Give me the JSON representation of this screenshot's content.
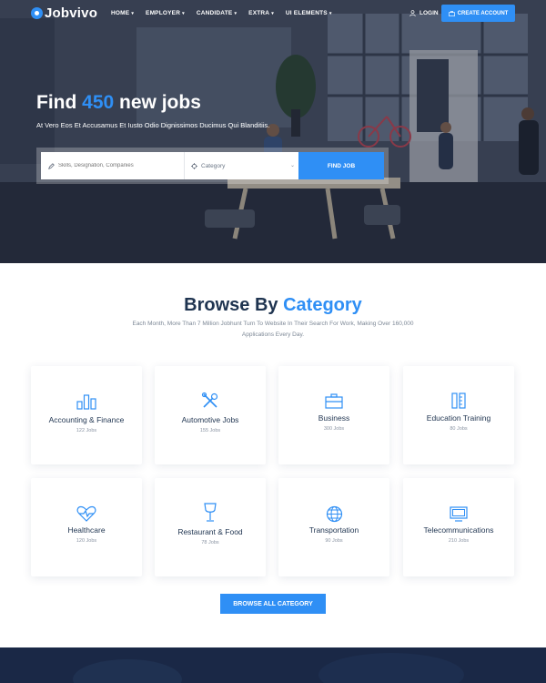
{
  "brand": {
    "name": "Jobvivo",
    "accent": "#2f8ff5",
    "dark": "#1f3450"
  },
  "nav": {
    "items": [
      {
        "label": "HOME"
      },
      {
        "label": "EMPLOYER"
      },
      {
        "label": "CANDIDATE"
      },
      {
        "label": "EXTRA"
      },
      {
        "label": "UI ELEMENTS"
      }
    ],
    "login": "LOGIN",
    "create_account": "CREATE ACCOUNT"
  },
  "hero": {
    "title_prefix": "Find ",
    "title_number": "450",
    "title_suffix": " new jobs",
    "subtitle": "At Vero Eos Et Accusamus Et Iusto Odio Dignissimos Ducimus Qui Blanditiis.",
    "search": {
      "keyword_placeholder": "Skills, Designation, Companies",
      "category_label": "Category",
      "button": "FIND JOB"
    }
  },
  "categories": {
    "title_prefix": "Browse By ",
    "title_accent": "Category",
    "description": "Each Month, More Than 7 Million Jobhunt Turn To Website In Their Search For Work, Making Over 160,000 Applications Every Day.",
    "items": [
      {
        "name": "Accounting & Finance",
        "count": "122 Jobs",
        "icon": "bar-chart-icon"
      },
      {
        "name": "Automotive Jobs",
        "count": "155 Jobs",
        "icon": "wrench-icon"
      },
      {
        "name": "Business",
        "count": "300 Jobs",
        "icon": "briefcase-icon"
      },
      {
        "name": "Education Training",
        "count": "80 Jobs",
        "icon": "pencil-ruler-icon"
      },
      {
        "name": "Healthcare",
        "count": "120 Jobs",
        "icon": "heartbeat-icon"
      },
      {
        "name": "Restaurant & Food",
        "count": "78 Jobs",
        "icon": "wine-glass-icon"
      },
      {
        "name": "Transportation",
        "count": "90 Jobs",
        "icon": "globe-icon"
      },
      {
        "name": "Telecommunications",
        "count": "210 Jobs",
        "icon": "monitor-icon"
      }
    ],
    "browse_all": "BROWSE ALL CATEGORY"
  }
}
